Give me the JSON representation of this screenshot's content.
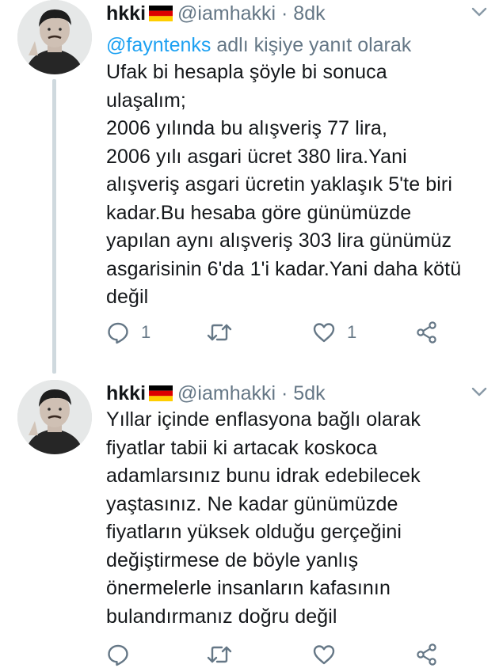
{
  "tweets": [
    {
      "name": "hkki",
      "handle": "@iamhakki",
      "dot": "·",
      "time": "8dk",
      "reply_prefix": "@fayntenks",
      "reply_suffix": " adlı kişiye yanıt olarak",
      "text": "Ufak bi hesapla şöyle bi sonuca\nulaşalım;\n2006 yılında bu alışveriş 77 lira,\n2006 yılı asgari ücret 380 lira.Yani\nalışveriş asgari ücretin yaklaşık 5'te biri\nkadar.Bu hesaba göre günümüzde\nyapılan aynı alışveriş 303 lira günümüz\nasgarisinin 6'da 1'i kadar.Yani daha kötü\ndeğil",
      "reply_count": "1",
      "retweet_count": "",
      "like_count": "1"
    },
    {
      "name": "hkki",
      "handle": "@iamhakki",
      "dot": "·",
      "time": "5dk",
      "text": "Yıllar içinde enflasyona bağlı olarak\nfiyatlar tabii ki artacak koskoca\nadamlarsınız bunu idrak edebilecek\nyaştasınız. Ne kadar günümüzde\nfiyatların yüksek olduğu gerçeğini\ndeğiştirmese de böyle yanlış\nönermelerle insanların kafasının\nbulandırmanız doğru değil",
      "reply_count": "",
      "retweet_count": "",
      "like_count": ""
    }
  ],
  "icons": {
    "flag": "germany-flag",
    "chevron": "chevron-down-icon",
    "reply": "reply-icon",
    "retweet": "retweet-icon",
    "like": "heart-icon",
    "share": "share-icon"
  },
  "colors": {
    "text": "#14171a",
    "muted": "#657786",
    "link": "#1da1f2",
    "thread_line": "#cfd9de"
  }
}
